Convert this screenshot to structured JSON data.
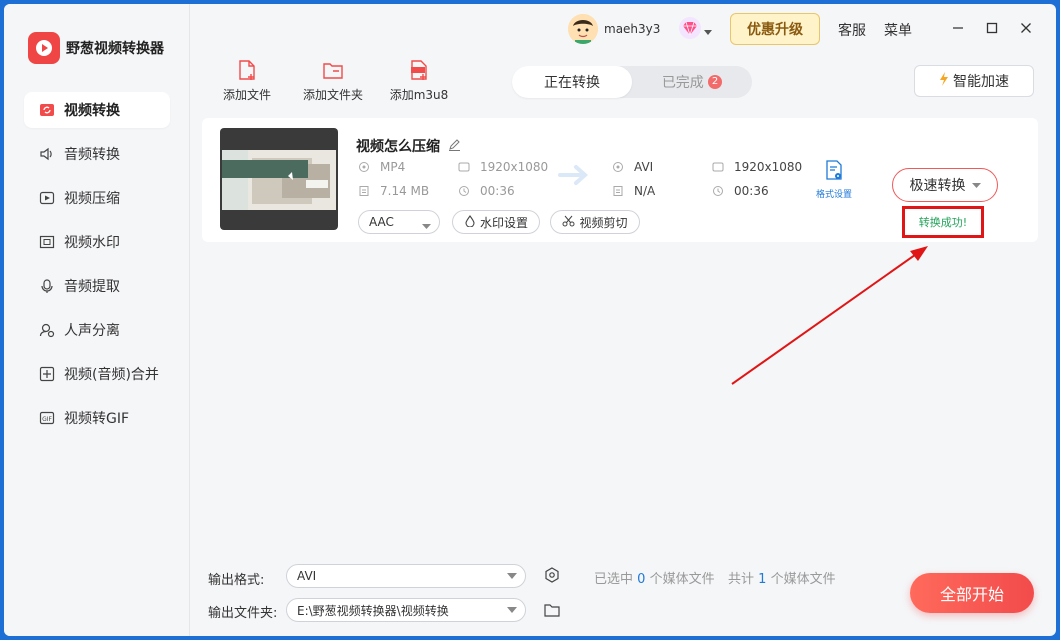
{
  "app": {
    "title": "野葱视频转换器"
  },
  "sidebar": {
    "items": [
      {
        "label": "视频转换",
        "icon": "video-convert-icon",
        "active": true
      },
      {
        "label": "音频转换",
        "icon": "audio-convert-icon"
      },
      {
        "label": "视频压缩",
        "icon": "video-compress-icon"
      },
      {
        "label": "视频水印",
        "icon": "watermark-icon"
      },
      {
        "label": "音频提取",
        "icon": "audio-extract-icon"
      },
      {
        "label": "人声分离",
        "icon": "voice-separate-icon"
      },
      {
        "label": "视频(音频)合并",
        "icon": "merge-icon"
      },
      {
        "label": "视频转GIF",
        "icon": "gif-icon"
      }
    ]
  },
  "header": {
    "username": "maeh3y3",
    "upgrade_label": "优惠升级",
    "service_label": "客服",
    "menu_label": "菜单"
  },
  "toolbar": {
    "add_file": "添加文件",
    "add_folder": "添加文件夹",
    "add_m3u8": "添加m3u8"
  },
  "tabs": {
    "converting": "正在转换",
    "done": "已完成",
    "done_count": "2"
  },
  "boost_label": "智能加速",
  "file": {
    "name": "视频怎么压缩",
    "src_format": "MP4",
    "src_resolution": "1920x1080",
    "src_size": "7.14 MB",
    "src_duration": "00:36",
    "dst_format": "AVI",
    "dst_resolution": "1920x1080",
    "dst_size": "N/A",
    "dst_duration": "00:36",
    "format_settings": "格式设置",
    "audio_codec": "AAC",
    "watermark_label": "水印设置",
    "cut_label": "视频剪切",
    "convert_label": "极速转换",
    "status": "转换成功!"
  },
  "bottom": {
    "output_format_label": "输出格式:",
    "output_format": "AVI",
    "output_folder_label": "输出文件夹:",
    "output_folder": "E:\\野葱视频转换器\\视频转换",
    "selected_prefix": "已选中",
    "selected_count": "0",
    "selected_suffix": "个媒体文件",
    "total_prefix": "共计",
    "total_count": "1",
    "total_suffix": "个媒体文件",
    "start_label": "全部开始"
  },
  "colors": {
    "accent": "#f24b4b",
    "link": "#1f7ad8",
    "success": "#23a35a",
    "annotation": "#e01515"
  }
}
